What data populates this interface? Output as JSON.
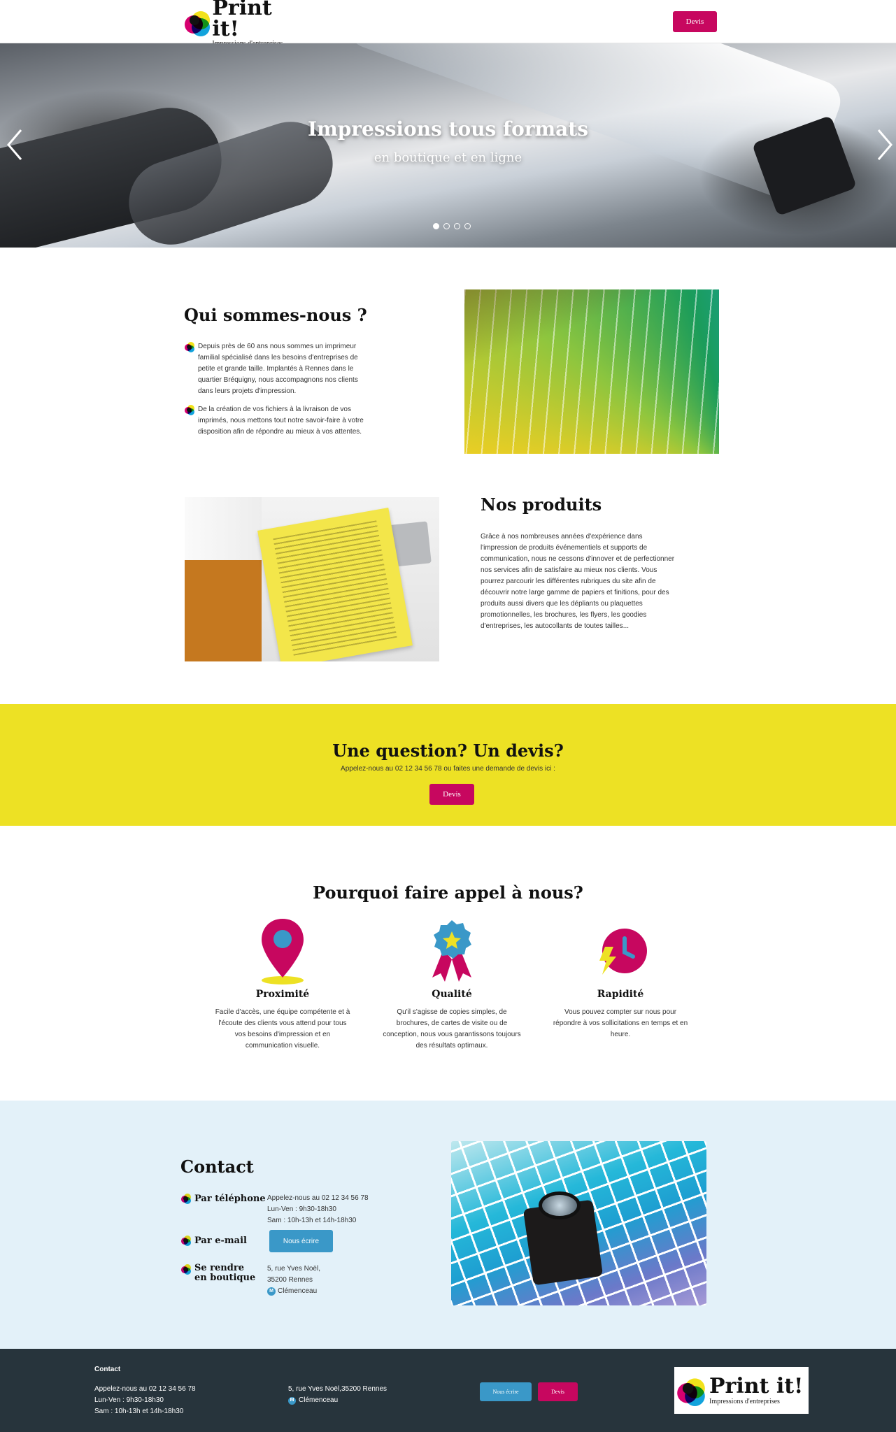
{
  "header": {
    "brand": "Print it!",
    "tagline": "Impressions d'entreprises",
    "devis_label": "Devis"
  },
  "hero": {
    "title": "Impressions tous formats",
    "subtitle": "en boutique et en ligne",
    "slides_count": 4,
    "active_slide": 1
  },
  "about": {
    "title": "Qui sommes-nous ?",
    "paragraphs": [
      "Depuis près de 60 ans nous sommes un imprimeur familial spécialisé dans les besoins d'entreprises de petite et grande taille. Implantés à Rennes dans le quartier Bréquigny, nous accompagnons nos clients dans leurs projets d'impression.",
      "De la création de vos fichiers à la livraison de vos imprimés, nous mettons tout notre savoir-faire à votre disposition afin de répondre au mieux à vos attentes."
    ]
  },
  "products": {
    "title": "Nos produits",
    "text": "Grâce à nos nombreuses années d'expérience dans l'impression de produits événementiels et supports de communication, nous ne cessons d'innover et de perfectionner nos services afin de satisfaire au mieux nos clients. Vous pourrez parcourir les différentes rubriques du site afin de découvrir notre large gamme de papiers et finitions, pour des produits aussi divers que les dépliants ou plaquettes promotionnelles, les brochures, les flyers, les goodies d'entreprises, les autocollants de toutes tailles..."
  },
  "cta": {
    "title": "Une question? Un devis?",
    "text": "Appelez-nous au 02 12 34 56 78 ou faites une demande de devis ici :",
    "button": "Devis"
  },
  "why": {
    "title": "Pourquoi faire appel à nous?",
    "items": [
      {
        "title": "Proximité",
        "text": "Facile d'accès, une équipe compétente et à l'écoute des clients vous attend pour tous vos besoins d'impression et en communication visuelle.",
        "icon": "location-pin-icon"
      },
      {
        "title": "Qualité",
        "text": "Qu'il s'agisse de copies simples, de brochures, de cartes de visite ou de conception, nous vous garantissons toujours des résultats optimaux.",
        "icon": "award-ribbon-icon"
      },
      {
        "title": "Rapidité",
        "text": "Vous pouvez compter sur nous pour répondre à vos sollicitations en temps et en heure.",
        "icon": "clock-lightning-icon"
      }
    ]
  },
  "contact": {
    "title": "Contact",
    "phone_label": "Par téléphone",
    "phone_lines": [
      "Appelez-nous au 02 12 34 56 78",
      "Lun-Ven : 9h30-18h30",
      "Sam : 10h-13h et 14h-18h30"
    ],
    "email_label": "Par e-mail",
    "email_button": "Nous écrire",
    "shop_label": "Se rendre en boutique",
    "address_lines": [
      "5, rue Yves Noël,",
      "35200 Rennes"
    ],
    "metro": "Clémenceau",
    "metro_badge": "M"
  },
  "footer": {
    "heading": "Contact",
    "phone_lines": [
      "Appelez-nous au 02 12 34 56 78",
      "Lun-Ven : 9h30-18h30",
      "Sam : 10h-13h et 14h-18h30"
    ],
    "address": "5, rue Yves Noël,35200 Rennes",
    "metro": "Clémenceau",
    "metro_badge": "M",
    "write_button": "Nous écrire",
    "devis_button": "Devis",
    "brand": "Print it!",
    "tagline": "Impressions d'entreprises"
  },
  "colors": {
    "magenta": "#c7075f",
    "yellow": "#ede124",
    "blue": "#3a98c8",
    "light_blue_bg": "#e3f1f9",
    "footer_bg": "#27343c"
  }
}
